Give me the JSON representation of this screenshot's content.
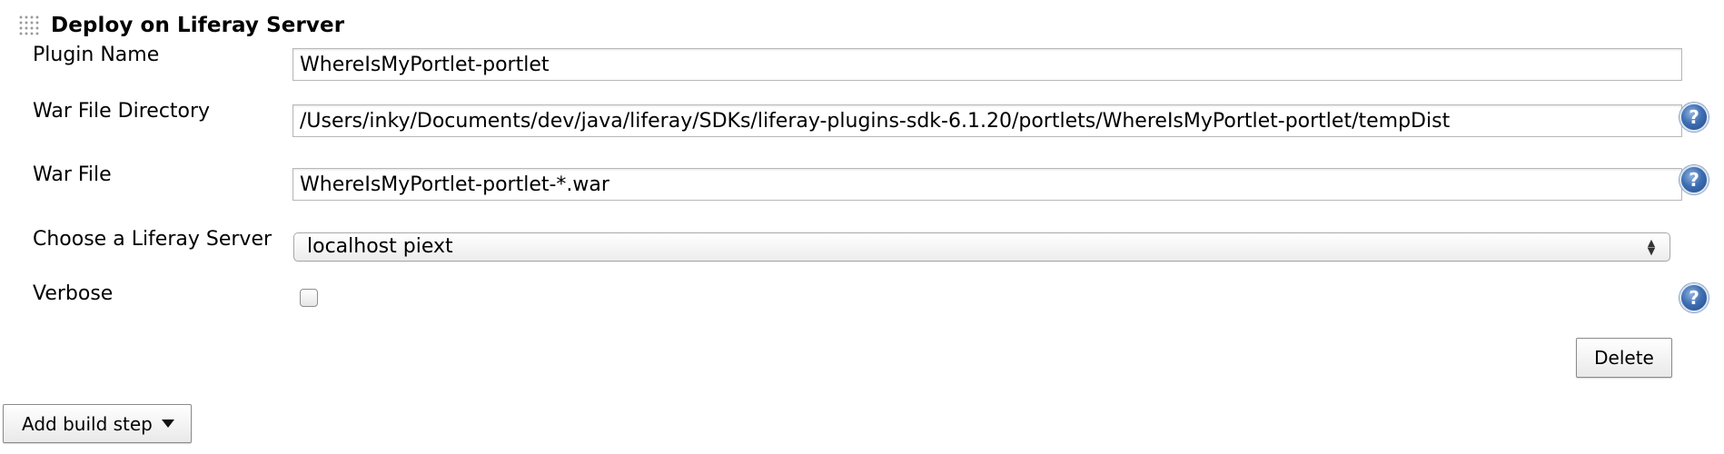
{
  "section": {
    "title": "Deploy on Liferay Server"
  },
  "fields": {
    "plugin_name": {
      "label": "Plugin Name",
      "value": "WhereIsMyPortlet-portlet"
    },
    "war_dir": {
      "label": "War File Directory",
      "value": "/Users/inky/Documents/dev/java/liferay/SDKs/liferay-plugins-sdk-6.1.20/portlets/WhereIsMyPortlet-portlet/tempDist"
    },
    "war_file": {
      "label": "War File",
      "value": "WhereIsMyPortlet-portlet-*.war"
    },
    "server": {
      "label": "Choose a Liferay Server",
      "selected": "localhost piext"
    },
    "verbose": {
      "label": "Verbose",
      "checked": false
    }
  },
  "help": {
    "glyph": "?"
  },
  "buttons": {
    "delete": "Delete",
    "add_build_step": "Add build step"
  },
  "icons": {
    "help": "help-icon",
    "grip": "drag-handle-icon",
    "dropdown": "chevron-updown-icon",
    "caret": "caret-down-icon"
  }
}
